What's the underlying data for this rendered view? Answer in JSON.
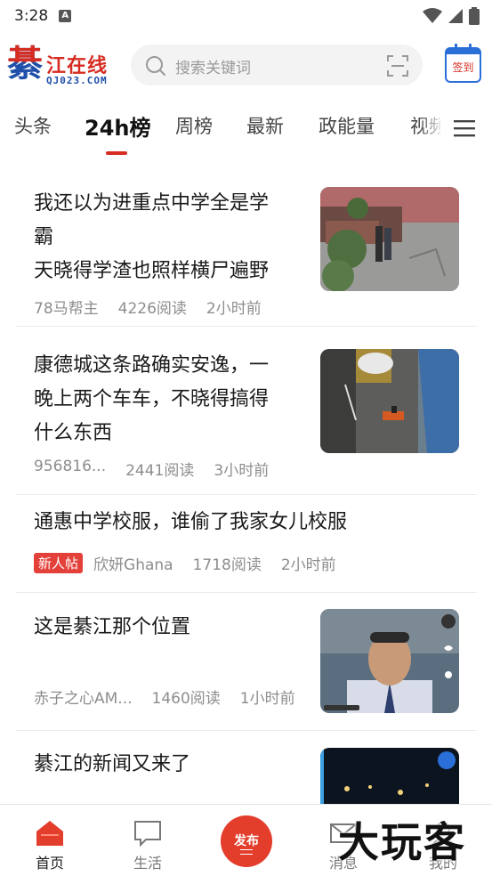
{
  "status_bar": {
    "time": "3:28",
    "notification_letter": "A"
  },
  "header": {
    "logo_char": "綦",
    "logo_title": "江在线",
    "logo_sub": "QJ023.COM",
    "search_placeholder": "搜索关键词",
    "signin_label": "签到"
  },
  "tabs": [
    {
      "label": "头条"
    },
    {
      "label": "24h榜",
      "active": true
    },
    {
      "label": "周榜"
    },
    {
      "label": "最新"
    },
    {
      "label": "政能量"
    },
    {
      "label": "视频"
    }
  ],
  "articles": [
    {
      "title": "我还以为进重点中学全是学\n霸\n天晓得学渣也照样横尸遍野",
      "author": "78马帮主",
      "reads": "4226阅读",
      "time": "2小时前",
      "thumb": "street-scene"
    },
    {
      "title": "康德城这条路确实安逸，一\n晚上两个车车，不晓得搞得\n什么东西",
      "author": "956816...",
      "reads": "2441阅读",
      "time": "3小时前",
      "thumb": "road-accident"
    },
    {
      "title": "通惠中学校服，谁偷了我家女儿校服",
      "tag": "新人帖",
      "author": "欣妍Ghana",
      "reads": "1718阅读",
      "time": "2小时前"
    },
    {
      "title": "这是綦江那个位置",
      "author": "赤子之心AM...",
      "reads": "1460阅读",
      "time": "1小时前",
      "thumb": "video-man"
    },
    {
      "title": "綦江的新闻又来了",
      "thumb": "night-video"
    }
  ],
  "bottom_nav": {
    "home_label": "首页",
    "life_label": "生活",
    "publish_label": "发布",
    "messages_label": "消息",
    "me_label": "我的"
  },
  "watermark": "大玩客",
  "colors": {
    "accent": "#e33d2c",
    "brand_blue": "#1f4fa8",
    "signin_blue": "#2a6fd8",
    "meta_gray": "#8d8d8d"
  }
}
